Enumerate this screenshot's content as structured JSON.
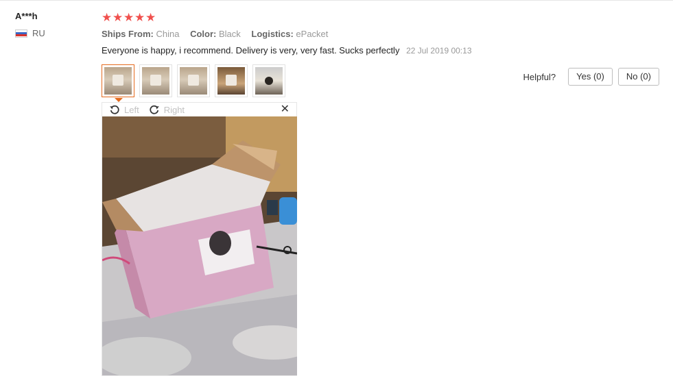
{
  "user": {
    "name": "A***h",
    "country": "RU"
  },
  "review": {
    "rating": 5,
    "star_glyph": "★",
    "meta": {
      "ships_from_label": "Ships From:",
      "ships_from_value": "China",
      "color_label": "Color:",
      "color_value": "Black",
      "logistics_label": "Logistics:",
      "logistics_value": "ePacket"
    },
    "text": "Everyone is happy, i recommend. Delivery is very, very fast. Sucks perfectly",
    "date": "22 Jul 2019 00:13",
    "thumbnails_count": 5
  },
  "viewer": {
    "rotate_left_label": "Left",
    "rotate_right_label": "Right",
    "close_glyph": "✕"
  },
  "helpful": {
    "label": "Helpful?",
    "yes_label": "Yes (0)",
    "no_label": "No (0)"
  },
  "colors": {
    "star": "#f0504d",
    "active_thumb": "#e46a1d"
  }
}
